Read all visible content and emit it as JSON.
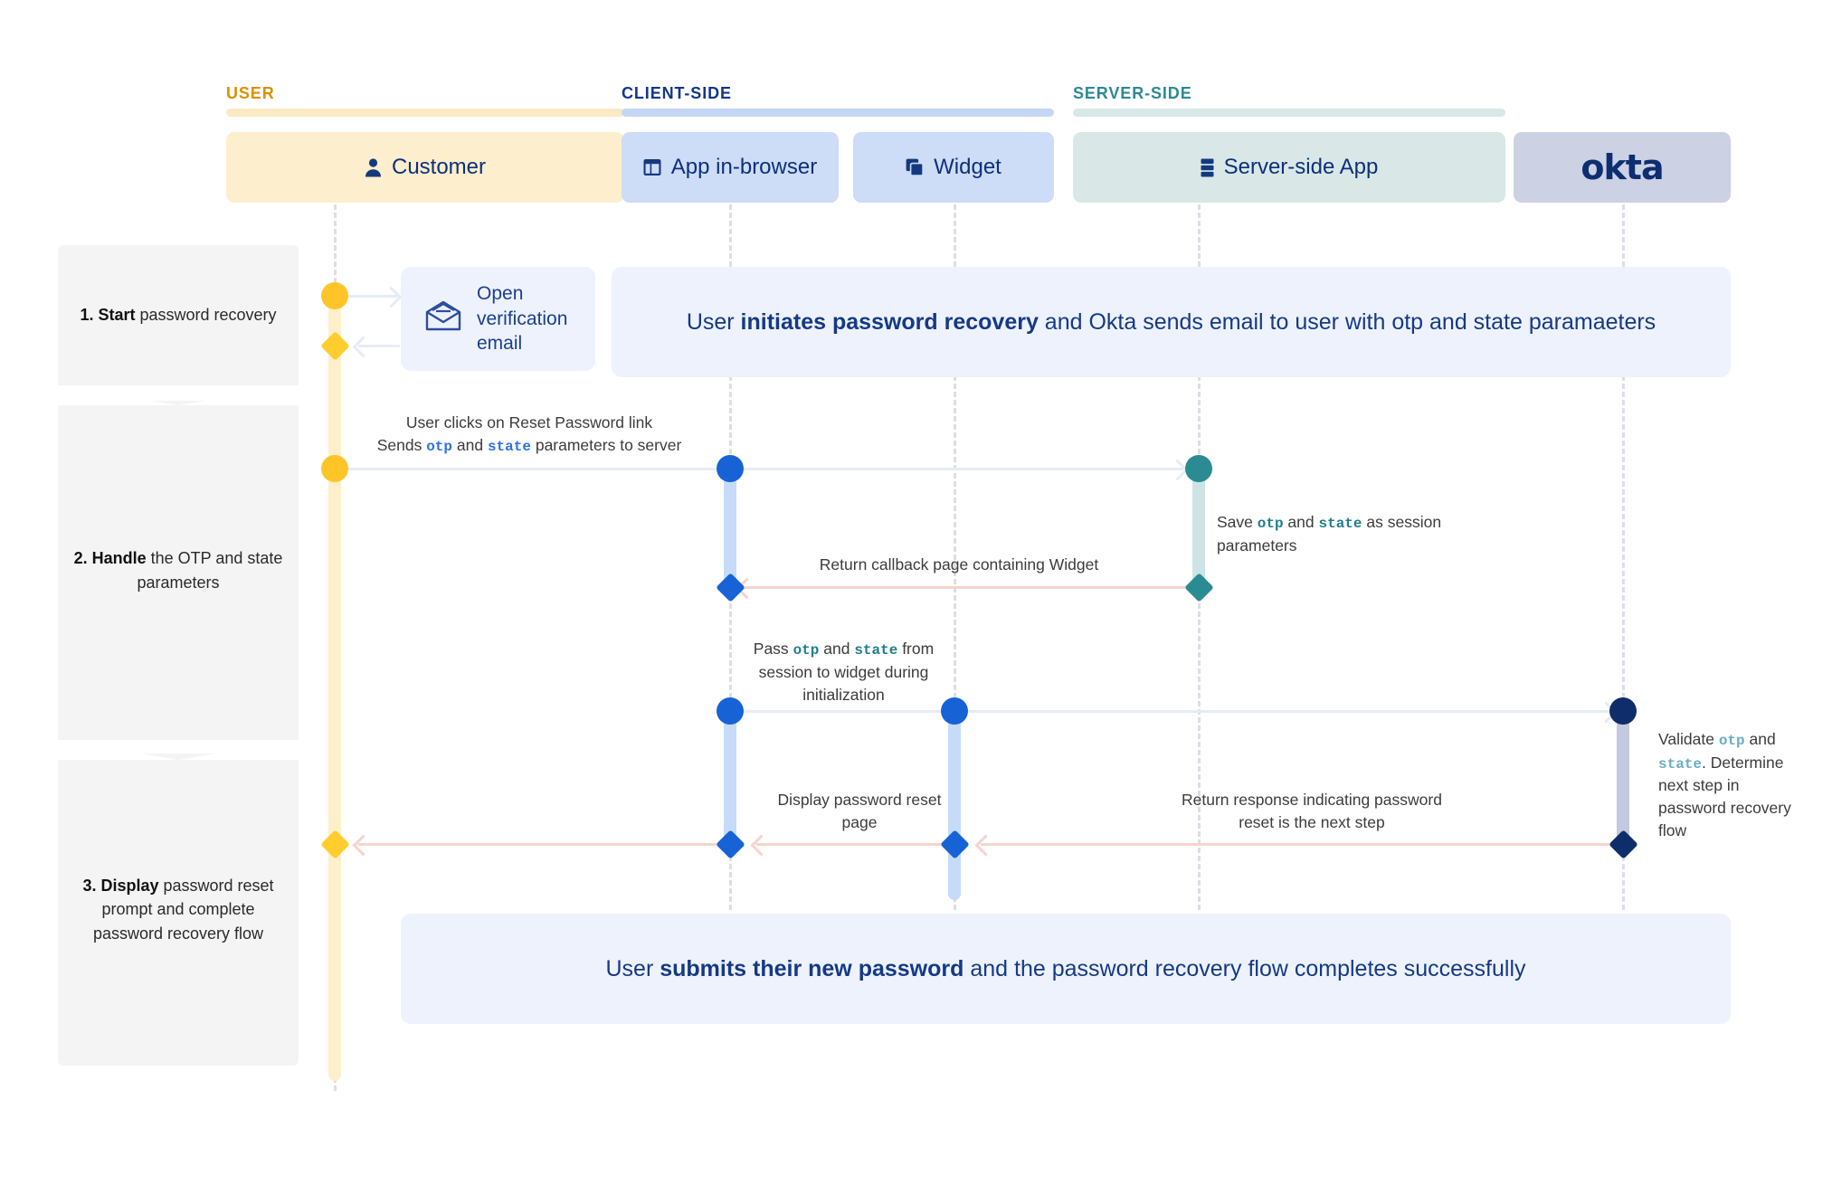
{
  "diagram": {
    "title": "Okta password recovery sequence diagram",
    "groups": [
      {
        "id": "user",
        "label": "USER",
        "color": "#d99100",
        "rule_color": "#fbeac4"
      },
      {
        "id": "client-side",
        "label": "CLIENT-SIDE",
        "color": "#12368f",
        "rule_color": "#c5d7f5"
      },
      {
        "id": "server-side",
        "label": "SERVER-SIDE",
        "color": "#2d8896",
        "rule_color": "#d6e8e7"
      }
    ],
    "actors": [
      {
        "id": "customer",
        "label": "Customer",
        "icon": "person-icon",
        "bg": "#fdeecd",
        "group": "user"
      },
      {
        "id": "app-browser",
        "label": "App in-browser",
        "icon": "browser-icon",
        "bg": "#cddcf7",
        "group": "client-side"
      },
      {
        "id": "widget",
        "label": "Widget",
        "icon": "layers-icon",
        "bg": "#cddcf7",
        "group": "client-side"
      },
      {
        "id": "server-app",
        "label": "Server-side App",
        "icon": "server-icon",
        "bg": "#d9e8e7",
        "group": "server-side"
      },
      {
        "id": "okta",
        "label": "okta",
        "icon": "okta-logo",
        "bg": "#ccd1e4",
        "group": ""
      }
    ],
    "steps": [
      {
        "id": "step-1",
        "number": "1.",
        "bold": "Start",
        "rest": " password recovery"
      },
      {
        "id": "step-2",
        "number": "2.",
        "bold": "Handle",
        "rest": " the OTP and state parameters"
      },
      {
        "id": "step-3",
        "number": "3.",
        "bold": "Display",
        "rest": " password reset prompt and complete password recovery flow"
      }
    ],
    "cards": {
      "email": {
        "icon": "open-envelope-icon",
        "label": "Open verification email"
      }
    },
    "banners": [
      {
        "id": "banner-start",
        "parts": [
          {
            "text": "User ",
            "bold": false
          },
          {
            "text": "initiates password recovery",
            "bold": true
          },
          {
            "text": " and Okta sends email to user with otp and state paramaeters",
            "bold": false
          }
        ]
      },
      {
        "id": "banner-complete",
        "parts": [
          {
            "text": "User ",
            "bold": false
          },
          {
            "text": "submits their new password",
            "bold": true
          },
          {
            "text": " and the password recovery flow completes successfully",
            "bold": false
          }
        ]
      }
    ],
    "messages": [
      {
        "id": "msg-reset-link",
        "parts": [
          {
            "text": "User clicks on Reset Password link",
            "style": "plain"
          },
          {
            "text": "\n",
            "style": "break"
          },
          {
            "text": "Sends ",
            "style": "plain"
          },
          {
            "text": "otp",
            "style": "code-blue"
          },
          {
            "text": " and ",
            "style": "plain"
          },
          {
            "text": "state",
            "style": "code-blue"
          },
          {
            "text": " parameters to server",
            "style": "plain"
          }
        ]
      },
      {
        "id": "msg-save-session",
        "parts": [
          {
            "text": "Save ",
            "style": "plain"
          },
          {
            "text": "otp",
            "style": "code-teal"
          },
          {
            "text": " and ",
            "style": "plain"
          },
          {
            "text": "state",
            "style": "code-teal"
          },
          {
            "text": " as session parameters",
            "style": "plain"
          }
        ]
      },
      {
        "id": "msg-return-callback",
        "parts": [
          {
            "text": "Return callback page containing Widget",
            "style": "plain"
          }
        ]
      },
      {
        "id": "msg-pass-to-widget",
        "parts": [
          {
            "text": "Pass ",
            "style": "plain"
          },
          {
            "text": "otp",
            "style": "code-teal"
          },
          {
            "text": " and ",
            "style": "plain"
          },
          {
            "text": "state",
            "style": "code-teal"
          },
          {
            "text": " from session to widget during initialization",
            "style": "plain"
          }
        ]
      },
      {
        "id": "msg-validate",
        "parts": [
          {
            "text": "Validate ",
            "style": "plain"
          },
          {
            "text": "otp",
            "style": "code-lteal"
          },
          {
            "text": " and ",
            "style": "plain"
          },
          {
            "text": "state",
            "style": "code-lteal"
          },
          {
            "text": ". Determine next step in password recovery flow",
            "style": "plain"
          }
        ]
      },
      {
        "id": "msg-return-response",
        "parts": [
          {
            "text": "Return response indicating password reset is the next step",
            "style": "plain"
          }
        ]
      },
      {
        "id": "msg-display-reset",
        "parts": [
          {
            "text": "Display password reset page",
            "style": "plain"
          }
        ]
      }
    ],
    "colors": {
      "user_accent": "#ffc528",
      "client_accent": "#1763d6",
      "server_accent": "#2a8b93",
      "okta_accent": "#0f2d6b",
      "forward_arrow": "#e6ecf6",
      "return_arrow": "#f6d4cd",
      "activation_user": "#fdefc9",
      "activation_client": "#c5dbf7",
      "activation_server": "#cee4e4",
      "activation_okta": "#c3c9de",
      "banner_bg": "#eef2fd",
      "step_bg": "#f4f4f4"
    }
  }
}
